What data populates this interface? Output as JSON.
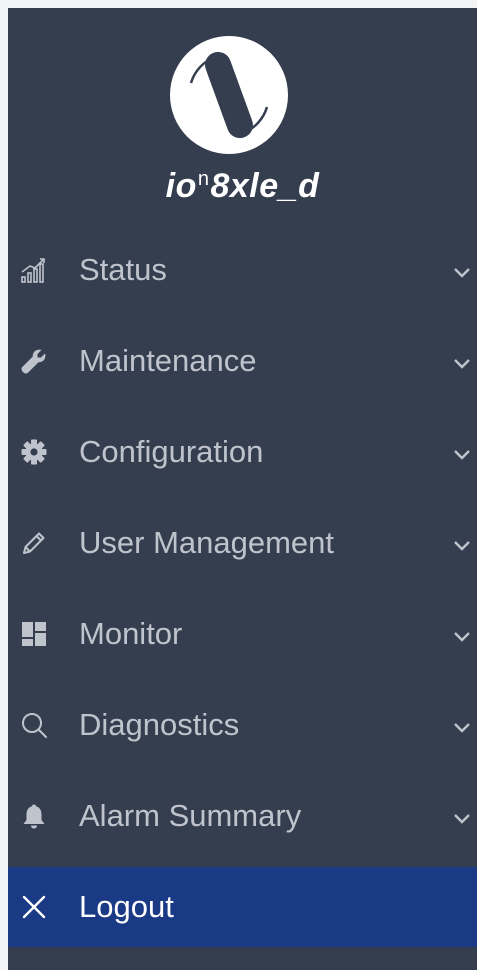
{
  "brand": {
    "name_prefix": "io",
    "name_sup": "n",
    "name_suffix": "8xle_d"
  },
  "colors": {
    "sidebar_bg": "#353e4f",
    "active_bg": "#1b3a85",
    "text": "#bfc4cc",
    "active_text": "#ffffff"
  },
  "nav": {
    "items": [
      {
        "label": "Status",
        "icon": "signal-bars-icon"
      },
      {
        "label": "Maintenance",
        "icon": "wrench-icon"
      },
      {
        "label": "Configuration",
        "icon": "gear-icon"
      },
      {
        "label": "User Management",
        "icon": "pencil-icon"
      },
      {
        "label": "Monitor",
        "icon": "dashboard-icon"
      },
      {
        "label": "Diagnostics",
        "icon": "search-icon"
      },
      {
        "label": "Alarm Summary",
        "icon": "bell-icon"
      }
    ],
    "logout": {
      "label": "Logout",
      "icon": "close-icon"
    }
  }
}
